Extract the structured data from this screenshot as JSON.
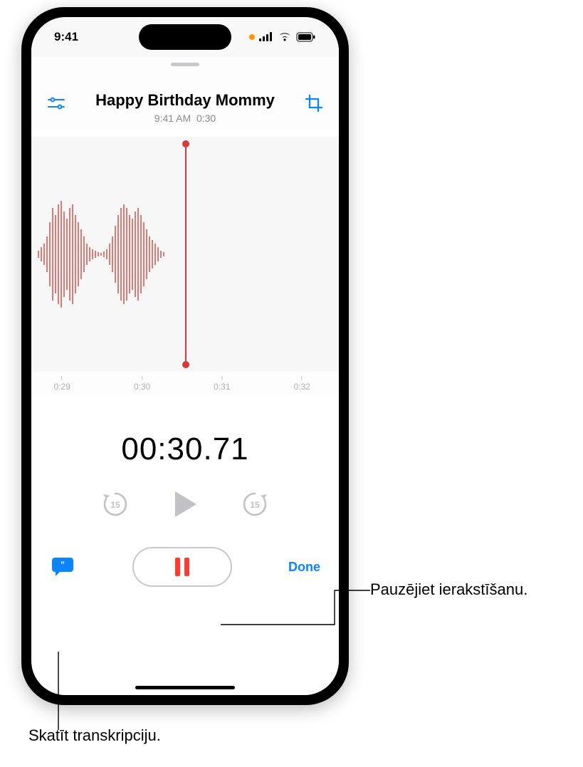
{
  "statusbar": {
    "time": "9:41"
  },
  "header": {
    "title": "Happy Birthday Mommy",
    "time": "9:41 AM",
    "duration": "0:30"
  },
  "ticks": [
    "0:29",
    "0:30",
    "0:31",
    "0:32"
  ],
  "timer": "00:30.71",
  "transport": {
    "skip_back": "15",
    "skip_fwd": "15"
  },
  "buttons": {
    "done": "Done"
  },
  "callouts": {
    "pause": "Pauzējiet ierakstīšanu.",
    "transcript": "Skatīt transkripciju."
  }
}
